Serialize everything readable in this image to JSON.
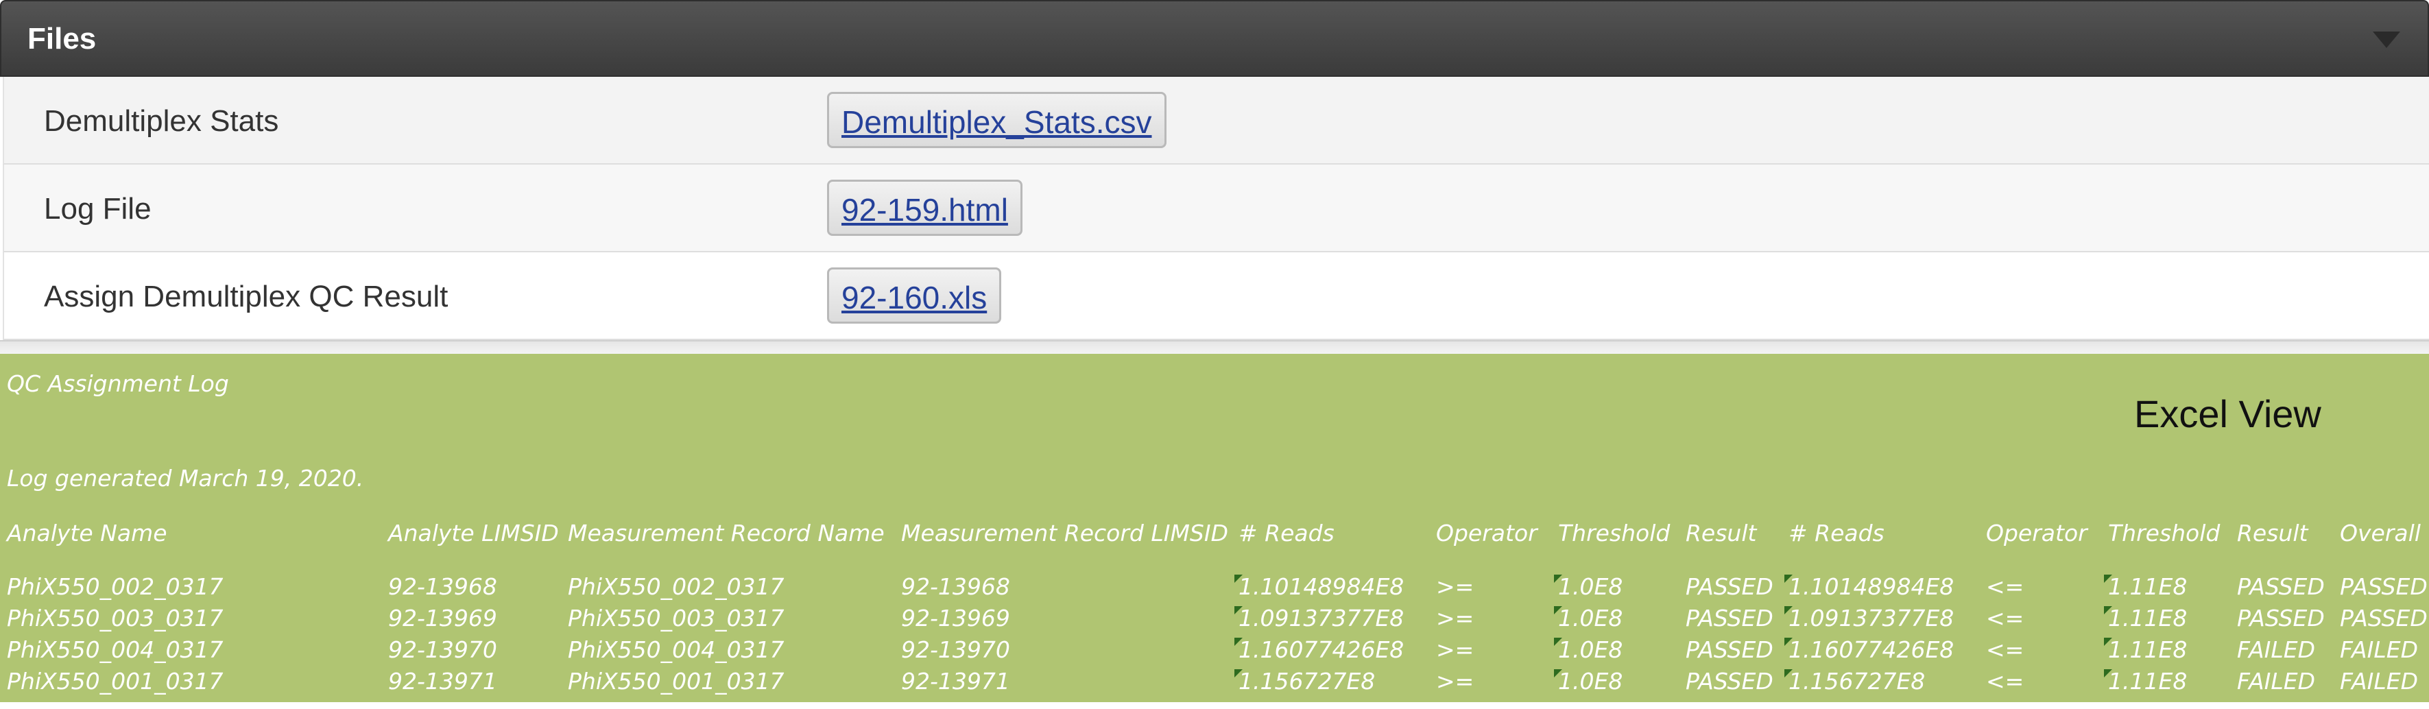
{
  "files_panel": {
    "title": "Files",
    "rows": [
      {
        "label": "Demultiplex Stats",
        "file": "Demultiplex_Stats.csv"
      },
      {
        "label": "Log File",
        "file": "92-159.html"
      },
      {
        "label": "Assign Demultiplex QC Result",
        "file": "92-160.xls"
      }
    ]
  },
  "excel": {
    "title": "QC Assignment Log",
    "view_label": "Excel View",
    "generated": "Log generated March 19, 2020.",
    "headers": [
      "Analyte Name",
      "Analyte LIMSID",
      "Measurement Record Name",
      "Measurement Record LIMSID",
      "# Reads",
      "Operator",
      "Threshold",
      "Result",
      "# Reads",
      "Operator",
      "Threshold",
      "Result",
      "Overall"
    ],
    "rows": [
      [
        "PhiX550_002_0317",
        "92-13968",
        "PhiX550_002_0317",
        "92-13968",
        "1.10148984E8",
        ">=",
        "1.0E8",
        "PASSED",
        "1.10148984E8",
        "<=",
        "1.11E8",
        "PASSED",
        "PASSED"
      ],
      [
        "PhiX550_003_0317",
        "92-13969",
        "PhiX550_003_0317",
        "92-13969",
        "1.09137377E8",
        ">=",
        "1.0E8",
        "PASSED",
        "1.09137377E8",
        "<=",
        "1.11E8",
        "PASSED",
        "PASSED"
      ],
      [
        "PhiX550_004_0317",
        "92-13970",
        "PhiX550_004_0317",
        "92-13970",
        "1.16077426E8",
        ">=",
        "1.0E8",
        "PASSED",
        "1.16077426E8",
        "<=",
        "1.11E8",
        "FAILED",
        "FAILED"
      ],
      [
        "PhiX550_001_0317",
        "92-13971",
        "PhiX550_001_0317",
        "92-13971",
        "1.156727E8",
        ">=",
        "1.0E8",
        "PASSED",
        "1.156727E8",
        "<=",
        "1.11E8",
        "FAILED",
        "FAILED"
      ]
    ],
    "colors": {
      "background": "#b0c572",
      "text": "#ffffff",
      "marker": "#2e6b1f"
    }
  }
}
